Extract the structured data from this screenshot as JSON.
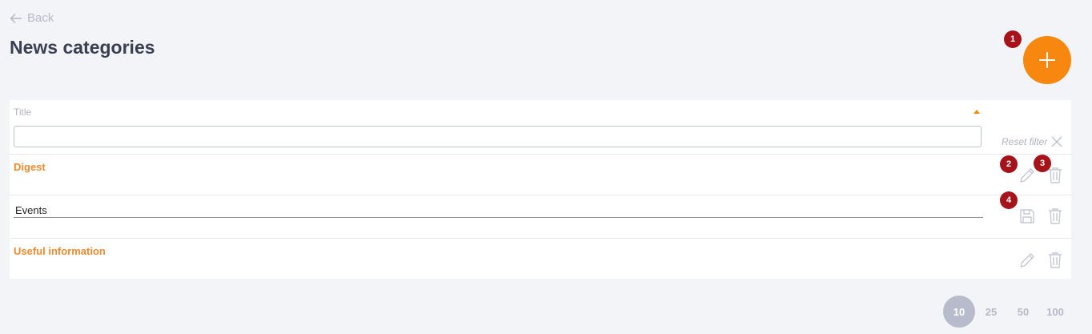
{
  "back": {
    "label": "Back"
  },
  "page": {
    "title": "News categories"
  },
  "markers": [
    "1",
    "2",
    "3",
    "4"
  ],
  "table": {
    "column_title": "Title",
    "filter_value": "",
    "reset_filter_label": "Reset filter",
    "rows": [
      {
        "title": "Digest",
        "mode": "view"
      },
      {
        "title": "Events",
        "mode": "edit"
      },
      {
        "title": "Useful information",
        "mode": "view"
      }
    ]
  },
  "pagination": {
    "sizes": [
      "10",
      "25",
      "50",
      "100"
    ],
    "selected": "10"
  },
  "colors": {
    "accent": "#f7870f",
    "link": "#ee8a2f",
    "badge": "#a6131b",
    "icon": "#c5c8d3"
  },
  "icons": [
    "arrow-left-icon",
    "plus-icon",
    "close-icon",
    "pencil-icon",
    "trash-icon",
    "save-icon"
  ]
}
